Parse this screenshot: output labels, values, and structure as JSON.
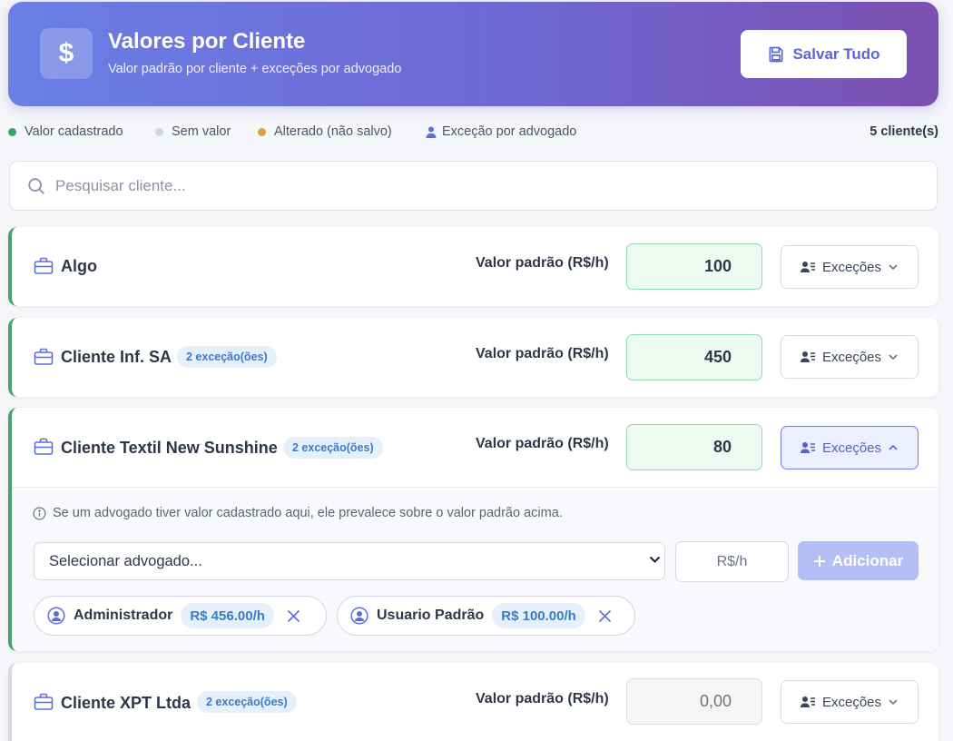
{
  "header": {
    "icon": "dollar-icon",
    "icon_glyph": "$",
    "title": "Valores por Cliente",
    "subtitle": "Valor padrão por cliente + exceções por advogado",
    "save_label": "Salvar Tudo"
  },
  "legend": {
    "items": [
      {
        "label": "Valor cadastrado",
        "color": "#3aa565"
      },
      {
        "label": "Sem valor",
        "color": "#cdd3db"
      },
      {
        "label": "Alterado (não salvo)",
        "color": "#dea036"
      },
      {
        "label": "Exceção por advogado",
        "icon": "person-icon",
        "color": "#5b6ee0"
      }
    ],
    "count": "5 cliente(s)"
  },
  "search": {
    "placeholder": "Pesquisar cliente..."
  },
  "value_label": "Valor padrão (R$/h)",
  "exceptions_label": "Exceções",
  "clients": [
    {
      "name": "Algo",
      "badge": "",
      "value": "100",
      "status": "filled"
    },
    {
      "name": "Cliente Inf. SA",
      "badge": "2 exceção(ões)",
      "value": "450",
      "status": "filled"
    },
    {
      "name": "Cliente Textil New Sunshine",
      "badge": "2 exceção(ões)",
      "value": "80",
      "status": "filled",
      "expanded": true
    },
    {
      "name": "Cliente XPT Ltda",
      "badge": "2 exceção(ões)",
      "value": "",
      "placeholder": "0,00",
      "status": "empty"
    }
  ],
  "panel": {
    "info": "Se um advogado tiver valor cadastrado aqui, ele prevalece sobre o valor padrão acima.",
    "select_placeholder": "Selecionar advogado...",
    "rate_placeholder": "R$/h",
    "add_label": "Adicionar",
    "exceptions": [
      {
        "name": "Administrador",
        "rate": "R$ 456.00/h"
      },
      {
        "name": "Usuario Padrão",
        "rate": "R$ 100.00/h"
      }
    ]
  },
  "colors": {
    "accent": "#5b66d6",
    "filled_border": "#48a56a",
    "badge_text": "#3b7bc4"
  }
}
